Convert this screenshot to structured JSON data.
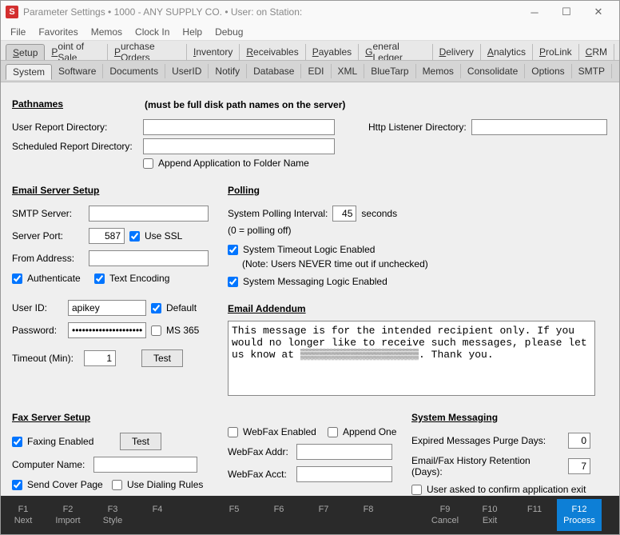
{
  "titlebar": {
    "app_icon_letter": "S",
    "title": "Parameter Settings   •   1000 - ANY SUPPLY CO.   •   User:               on Station:"
  },
  "menu": [
    "File",
    "Favorites",
    "Memos",
    "Clock In",
    "Help",
    "Debug"
  ],
  "tabs1": [
    "Setup",
    "Point of Sale",
    "Purchase Orders",
    "Inventory",
    "Receivables",
    "Payables",
    "General Ledger",
    "Delivery",
    "Analytics",
    "ProLink",
    "CRM"
  ],
  "tabs1_active": 0,
  "tabs2": [
    "System",
    "Software",
    "Documents",
    "UserID",
    "Notify",
    "Database",
    "EDI",
    "XML",
    "BlueTarp",
    "Memos",
    "Consolidate",
    "Options",
    "SMTP"
  ],
  "tabs2_active": 0,
  "pathnames": {
    "header": "Pathnames",
    "note": "(must be full disk path names on the server)",
    "user_report_label": "User Report Directory:",
    "user_report_value": "",
    "sched_report_label": "Scheduled Report Directory:",
    "sched_report_value": "",
    "http_listener_label": "Http Listener Directory:",
    "http_listener_value": "",
    "append_label": "Append Application to Folder Name",
    "append_checked": false
  },
  "email": {
    "header": "Email Server Setup",
    "smtp_label": "SMTP Server:",
    "smtp_value": "",
    "port_label": "Server Port:",
    "port_value": "587",
    "ssl_label": "Use SSL",
    "ssl_checked": true,
    "from_label": "From Address:",
    "from_value": "",
    "auth_label": "Authenticate",
    "auth_checked": true,
    "textenc_label": "Text Encoding",
    "textenc_checked": true,
    "userid_label": "User ID:",
    "userid_value": "apikey",
    "default_label": "Default",
    "default_checked": true,
    "password_label": "Password:",
    "password_value": "************************",
    "ms365_label": "MS 365",
    "ms365_checked": false,
    "timeout_label": "Timeout (Min):",
    "timeout_value": "1",
    "test_button": "Test"
  },
  "polling": {
    "header": "Polling",
    "interval_label": "System Polling Interval:",
    "interval_value": "45",
    "interval_unit": "seconds",
    "interval_note": "(0 = polling off)",
    "timeout_enabled_label": "System Timeout Logic Enabled",
    "timeout_enabled_checked": true,
    "timeout_note": "(Note: Users NEVER time out if unchecked)",
    "messaging_enabled_label": "System Messaging Logic Enabled",
    "messaging_enabled_checked": true
  },
  "addendum": {
    "header": "Email Addendum",
    "text": "This message is for the intended recipient only. If you would no longer like to receive such messages, please let us know at ▒▒▒▒▒▒▒▒▒▒▒▒▒▒▒▒▒▒▒. Thank you."
  },
  "fax": {
    "header": "Fax Server Setup",
    "enabled_label": "Faxing Enabled",
    "enabled_checked": true,
    "test_button": "Test",
    "computer_label": "Computer Name:",
    "computer_value": "",
    "cover_label": "Send Cover Page",
    "cover_checked": true,
    "dialing_label": "Use Dialing Rules",
    "dialing_checked": false,
    "webfax_enabled_label": "WebFax Enabled",
    "webfax_enabled_checked": false,
    "append_one_label": "Append One",
    "append_one_checked": false,
    "webfax_addr_label": "WebFax Addr:",
    "webfax_addr_value": "",
    "webfax_acct_label": "WebFax Acct:",
    "webfax_acct_value": ""
  },
  "sysmsg": {
    "header": "System Messaging",
    "purge_label": "Expired Messages Purge Days:",
    "purge_value": "0",
    "history_label": "Email/Fax History Retention (Days):",
    "history_value": "7",
    "confirm_exit_label": "User asked to confirm application exit",
    "confirm_exit_checked": false
  },
  "fkeys": [
    {
      "fn": "F1",
      "label": "Next"
    },
    {
      "fn": "F2",
      "label": "Import"
    },
    {
      "fn": "F3",
      "label": "Style"
    },
    {
      "fn": "F4",
      "label": ""
    },
    {
      "fn": "",
      "label": ""
    },
    {
      "fn": "F5",
      "label": ""
    },
    {
      "fn": "F6",
      "label": ""
    },
    {
      "fn": "F7",
      "label": ""
    },
    {
      "fn": "F8",
      "label": ""
    },
    {
      "fn": "",
      "label": ""
    },
    {
      "fn": "F9",
      "label": "Cancel"
    },
    {
      "fn": "F10",
      "label": "Exit"
    },
    {
      "fn": "F11",
      "label": ""
    },
    {
      "fn": "F12",
      "label": "Process"
    }
  ],
  "fkey_active": 13
}
